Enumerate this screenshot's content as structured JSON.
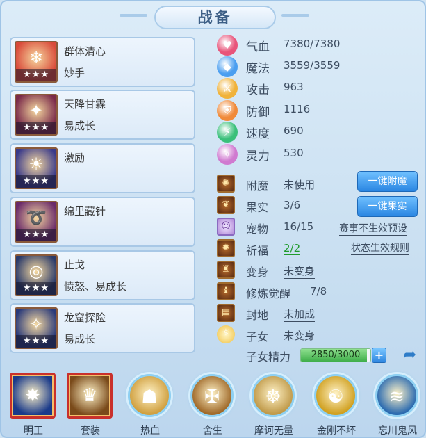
{
  "title": "战备",
  "skills": [
    {
      "name": "群体清心",
      "sub": "妙手",
      "stars": "★★★",
      "icon": "popsicle-icon",
      "glyph": "❄",
      "bg": "#d94a3a"
    },
    {
      "name": "天降甘霖",
      "sub": "易成长",
      "stars": "★★★",
      "icon": "rain-crystal-icon",
      "glyph": "✦",
      "bg": "#7a2a4a"
    },
    {
      "name": "激励",
      "sub": "",
      "stars": "★★★",
      "icon": "mask-icon",
      "glyph": "☀",
      "bg": "#3a3a8a"
    },
    {
      "name": "绵里藏针",
      "sub": "",
      "stars": "★★★",
      "icon": "chain-icon",
      "glyph": "➰",
      "bg": "#6a2a6a"
    },
    {
      "name": "止戈",
      "sub": "愤怒、易成长",
      "stars": "★★★",
      "icon": "ring-icon",
      "glyph": "◎",
      "bg": "#2a3a6a"
    },
    {
      "name": "龙窟探险",
      "sub": "易成长",
      "stars": "★★★",
      "icon": "crystal-icon",
      "glyph": "✧",
      "bg": "#2a3a7a"
    }
  ],
  "stats": [
    {
      "label": "气血",
      "value": "7380/7380",
      "icon": "heart-icon",
      "glyph": "♥",
      "color": "#e8547a"
    },
    {
      "label": "魔法",
      "value": "3559/3559",
      "icon": "mana-icon",
      "glyph": "◆",
      "color": "#4a9ef0"
    },
    {
      "label": "攻击",
      "value": "963",
      "icon": "attack-icon",
      "glyph": "⚔",
      "color": "#f0b23a"
    },
    {
      "label": "防御",
      "value": "1116",
      "icon": "shield-icon",
      "glyph": "⛨",
      "color": "#f08a3a"
    },
    {
      "label": "速度",
      "value": "690",
      "icon": "speed-icon",
      "glyph": "⚡",
      "color": "#3ac07a"
    },
    {
      "label": "灵力",
      "value": "530",
      "icon": "spirit-icon",
      "glyph": "✧",
      "color": "#d07ad0"
    }
  ],
  "attrs": [
    {
      "label": "附魔",
      "value": "未使用",
      "icon": "enchant-icon",
      "glyph": "✺"
    },
    {
      "label": "果实",
      "value": "3/6",
      "icon": "fruit-icon",
      "glyph": "❦"
    },
    {
      "label": "宠物",
      "value": "16/15",
      "icon": "pet-icon",
      "glyph": "☺"
    },
    {
      "label": "祈福",
      "value": "2/2",
      "icon": "blessing-icon",
      "glyph": "✹"
    },
    {
      "label": "变身",
      "value": "未变身",
      "icon": "transform-icon",
      "glyph": "♜"
    },
    {
      "label": "修炼觉醒",
      "value": "7/8",
      "icon": "awaken-icon",
      "glyph": "♝"
    },
    {
      "label": "封地",
      "value": "未加成",
      "icon": "fief-icon",
      "glyph": "▤"
    },
    {
      "label": "子女",
      "value": "未变身",
      "icon": "child-icon",
      "glyph": "☼"
    }
  ],
  "child_energy": {
    "label": "子女精力",
    "value": "2850/3000",
    "current": 2850,
    "max": 3000
  },
  "buttons": {
    "enchant": "一键附魔",
    "fruit": "一键果实",
    "event_link": "赛事不生效预设",
    "status_link": "状态生效规则",
    "plus": "+"
  },
  "bottom": [
    {
      "label": "明王",
      "icon": "mingwang-icon",
      "glyph": "✸",
      "style": "square",
      "bg": "#1a3a8a",
      "underline": true
    },
    {
      "label": "套装",
      "icon": "armor-set-icon",
      "glyph": "♛",
      "style": "square",
      "bg": "#7a4a1a",
      "underline": true
    },
    {
      "label": "热血",
      "icon": "hot-blood-icon",
      "glyph": "☗",
      "style": "circle",
      "bg": "#d0a040",
      "underline": false
    },
    {
      "label": "舍生",
      "icon": "sacrifice-icon",
      "glyph": "✠",
      "style": "circle",
      "bg": "#a06a2a",
      "underline": false
    },
    {
      "label": "摩诃无量",
      "icon": "mahe-icon",
      "glyph": "☸",
      "style": "circle",
      "bg": "#c09a4a",
      "underline": false
    },
    {
      "label": "金刚不坏",
      "icon": "vajra-icon",
      "glyph": "☯",
      "style": "circle",
      "bg": "#d0a020",
      "underline": false
    },
    {
      "label": "忘川鬼风",
      "icon": "ghost-wind-icon",
      "glyph": "≋",
      "style": "circle",
      "bg": "#2a6ab0",
      "underline": false
    }
  ],
  "colors": {
    "accent_blue": "#2a86e2",
    "green": "#1f9a2c",
    "panel": "#dcecf8"
  }
}
